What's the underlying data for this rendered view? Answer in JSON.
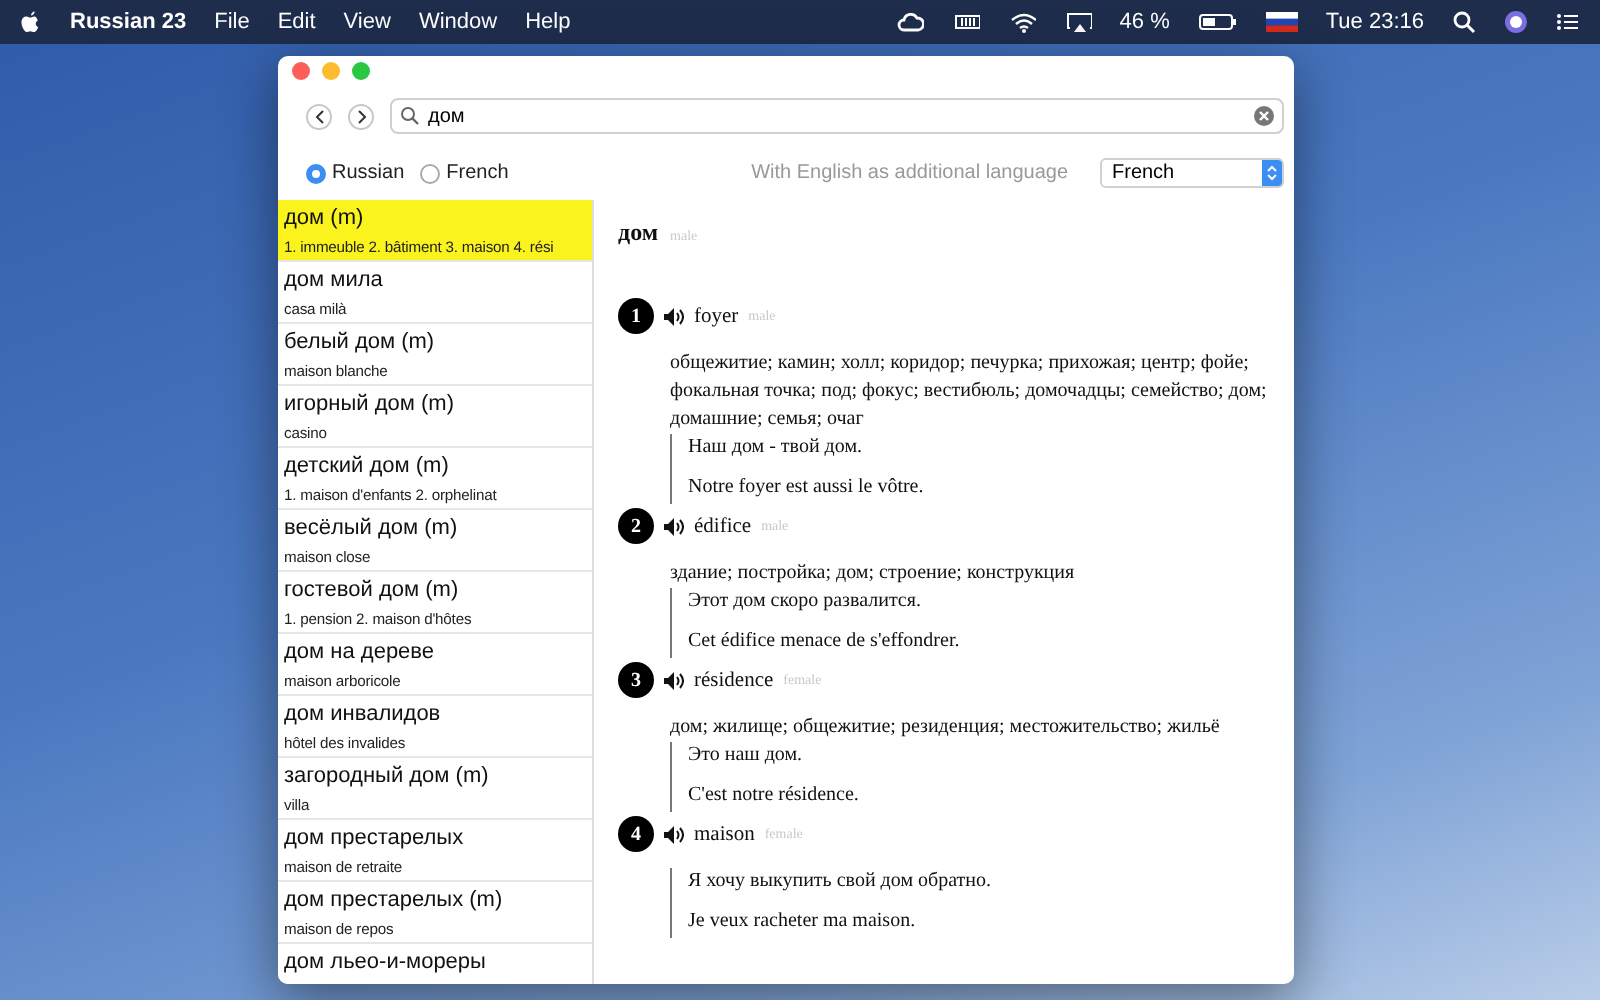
{
  "menu_bar": {
    "app_name": "Russian 23",
    "menus": [
      "File",
      "Edit",
      "View",
      "Window",
      "Help"
    ],
    "battery": "46 %",
    "clock": "Tue 23:16"
  },
  "toolbar": {
    "search": {
      "value": "дом"
    }
  },
  "options": {
    "languages": [
      {
        "label": "Russian",
        "selected": true
      },
      {
        "label": "French",
        "selected": false
      }
    ],
    "additional_label": "With English as additional language",
    "select_value": "French"
  },
  "results": [
    {
      "title": "дом (m)",
      "subtitle": "1. immeuble 2. bâtiment 3. maison 4. rési",
      "selected": true
    },
    {
      "title": "дом мила",
      "subtitle": "casa milà",
      "selected": false
    },
    {
      "title": "белый дом (m)",
      "subtitle": "maison blanche",
      "selected": false
    },
    {
      "title": "игорный дом (m)",
      "subtitle": "casino",
      "selected": false
    },
    {
      "title": "детский дом (m)",
      "subtitle": "1. maison d'enfants 2. orphelinat",
      "selected": false
    },
    {
      "title": "весёлый дом (m)",
      "subtitle": "maison close",
      "selected": false
    },
    {
      "title": "гостевой дом (m)",
      "subtitle": "1. pension 2. maison d'hôtes",
      "selected": false
    },
    {
      "title": "дом на дереве",
      "subtitle": "maison arboricole",
      "selected": false
    },
    {
      "title": "дом инвалидов",
      "subtitle": "hôtel des invalides",
      "selected": false
    },
    {
      "title": "загородный дом (m)",
      "subtitle": "villa",
      "selected": false
    },
    {
      "title": "дом престарелых",
      "subtitle": "maison de retraite",
      "selected": false
    },
    {
      "title": "дом престарелых (m)",
      "subtitle": "maison de repos",
      "selected": false
    },
    {
      "title": "дом льео-и-мореры",
      "selected": false
    }
  ],
  "entry": {
    "headword": "дом",
    "gender": "male",
    "senses": [
      {
        "number": "1",
        "word": "foyer",
        "gender": "male",
        "translations": "общежитие; камин; холл; коридор; печурка; прихожая; центр; фойе; фокальная точка; под; фокус; вестибюль; домочадцы; семейство; дом; домашние; семья; очаг",
        "examples": [
          "Наш дом - твой дом.",
          "Notre foyer est aussi le vôtre."
        ]
      },
      {
        "number": "2",
        "word": "édifice",
        "gender": "male",
        "translations": "здание; постройка; дом; строение; конструкция",
        "examples": [
          "Этот дом скоро развалится.",
          "Cet édifice menace de s'effondrer."
        ]
      },
      {
        "number": "3",
        "word": "résidence",
        "gender": "female",
        "translations": "дом; жилище; общежитие; резиденция; местожительство; жильё",
        "examples": [
          "Это наш дом.",
          "C'est notre résidence."
        ]
      },
      {
        "number": "4",
        "word": "maison",
        "gender": "female",
        "examples": [
          "Я хочу выкупить свой дом обратно.",
          "Je veux racheter ma maison."
        ]
      }
    ]
  }
}
